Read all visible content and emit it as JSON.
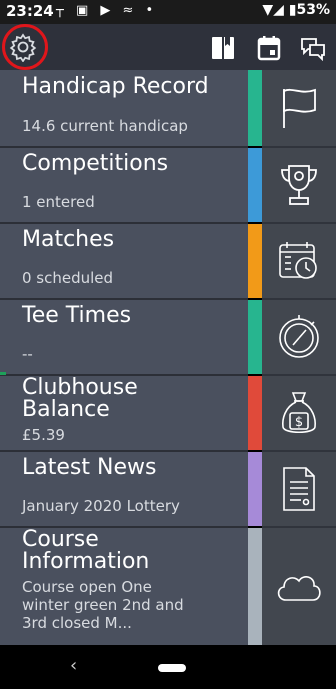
{
  "status_bar": {
    "time": "23:24",
    "notifications": "┬ ▣ ▶ ≈ •",
    "battery": "▼◢ ▮53%"
  },
  "header": {
    "icons": [
      "settings-gear-icon",
      "bookmark-book-icon",
      "calendar-icon",
      "chat-bubbles-icon"
    ]
  },
  "tiles": [
    {
      "title": "Handicap Record",
      "subtitle": "14.6 current handicap",
      "stripe_color": "#27b58f",
      "icon": "flag-icon"
    },
    {
      "title": "Competitions",
      "subtitle": "1 entered",
      "stripe_color": "#3d9ad8",
      "icon": "trophy-icon"
    },
    {
      "title": "Matches",
      "subtitle": "0 scheduled",
      "stripe_color": "#f29a18",
      "icon": "calendar-clock-icon"
    },
    {
      "title": "Tee Times",
      "subtitle": "--",
      "stripe_color": "#27b58f",
      "icon": "stopwatch-icon"
    },
    {
      "title_line1": "Clubhouse",
      "title_line2": "Balance",
      "subtitle": "£5.39",
      "stripe_color": "#e04a3a",
      "icon": "money-bag-icon"
    },
    {
      "title": "Latest News",
      "subtitle": "January 2020 Lottery",
      "stripe_color": "#a68ad8",
      "icon": "document-icon"
    },
    {
      "title_line1": "Course",
      "title_line2": "Information",
      "sub_line1": "Course open One",
      "sub_line2": "winter green 2nd and",
      "sub_line3": "3rd closed M...",
      "stripe_color": "#a9b3bc",
      "icon": "cloud-icon"
    }
  ],
  "navbar": {
    "back_glyph": "‹"
  }
}
